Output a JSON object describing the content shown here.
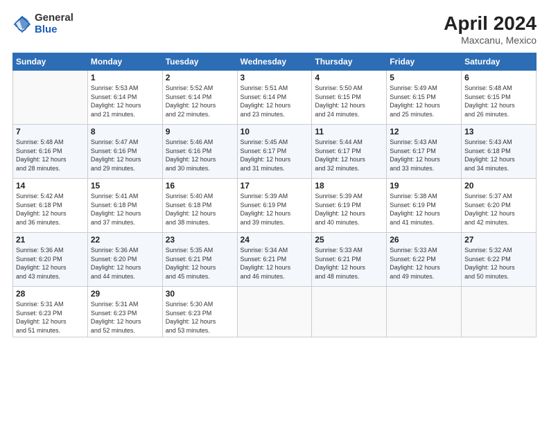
{
  "logo": {
    "general": "General",
    "blue": "Blue"
  },
  "title": "April 2024",
  "subtitle": "Maxcanu, Mexico",
  "days_of_week": [
    "Sunday",
    "Monday",
    "Tuesday",
    "Wednesday",
    "Thursday",
    "Friday",
    "Saturday"
  ],
  "weeks": [
    [
      {
        "num": "",
        "info": ""
      },
      {
        "num": "1",
        "info": "Sunrise: 5:53 AM\nSunset: 6:14 PM\nDaylight: 12 hours\nand 21 minutes."
      },
      {
        "num": "2",
        "info": "Sunrise: 5:52 AM\nSunset: 6:14 PM\nDaylight: 12 hours\nand 22 minutes."
      },
      {
        "num": "3",
        "info": "Sunrise: 5:51 AM\nSunset: 6:14 PM\nDaylight: 12 hours\nand 23 minutes."
      },
      {
        "num": "4",
        "info": "Sunrise: 5:50 AM\nSunset: 6:15 PM\nDaylight: 12 hours\nand 24 minutes."
      },
      {
        "num": "5",
        "info": "Sunrise: 5:49 AM\nSunset: 6:15 PM\nDaylight: 12 hours\nand 25 minutes."
      },
      {
        "num": "6",
        "info": "Sunrise: 5:48 AM\nSunset: 6:15 PM\nDaylight: 12 hours\nand 26 minutes."
      }
    ],
    [
      {
        "num": "7",
        "info": "Sunrise: 5:48 AM\nSunset: 6:16 PM\nDaylight: 12 hours\nand 28 minutes."
      },
      {
        "num": "8",
        "info": "Sunrise: 5:47 AM\nSunset: 6:16 PM\nDaylight: 12 hours\nand 29 minutes."
      },
      {
        "num": "9",
        "info": "Sunrise: 5:46 AM\nSunset: 6:16 PM\nDaylight: 12 hours\nand 30 minutes."
      },
      {
        "num": "10",
        "info": "Sunrise: 5:45 AM\nSunset: 6:17 PM\nDaylight: 12 hours\nand 31 minutes."
      },
      {
        "num": "11",
        "info": "Sunrise: 5:44 AM\nSunset: 6:17 PM\nDaylight: 12 hours\nand 32 minutes."
      },
      {
        "num": "12",
        "info": "Sunrise: 5:43 AM\nSunset: 6:17 PM\nDaylight: 12 hours\nand 33 minutes."
      },
      {
        "num": "13",
        "info": "Sunrise: 5:43 AM\nSunset: 6:18 PM\nDaylight: 12 hours\nand 34 minutes."
      }
    ],
    [
      {
        "num": "14",
        "info": "Sunrise: 5:42 AM\nSunset: 6:18 PM\nDaylight: 12 hours\nand 36 minutes."
      },
      {
        "num": "15",
        "info": "Sunrise: 5:41 AM\nSunset: 6:18 PM\nDaylight: 12 hours\nand 37 minutes."
      },
      {
        "num": "16",
        "info": "Sunrise: 5:40 AM\nSunset: 6:18 PM\nDaylight: 12 hours\nand 38 minutes."
      },
      {
        "num": "17",
        "info": "Sunrise: 5:39 AM\nSunset: 6:19 PM\nDaylight: 12 hours\nand 39 minutes."
      },
      {
        "num": "18",
        "info": "Sunrise: 5:39 AM\nSunset: 6:19 PM\nDaylight: 12 hours\nand 40 minutes."
      },
      {
        "num": "19",
        "info": "Sunrise: 5:38 AM\nSunset: 6:19 PM\nDaylight: 12 hours\nand 41 minutes."
      },
      {
        "num": "20",
        "info": "Sunrise: 5:37 AM\nSunset: 6:20 PM\nDaylight: 12 hours\nand 42 minutes."
      }
    ],
    [
      {
        "num": "21",
        "info": "Sunrise: 5:36 AM\nSunset: 6:20 PM\nDaylight: 12 hours\nand 43 minutes."
      },
      {
        "num": "22",
        "info": "Sunrise: 5:36 AM\nSunset: 6:20 PM\nDaylight: 12 hours\nand 44 minutes."
      },
      {
        "num": "23",
        "info": "Sunrise: 5:35 AM\nSunset: 6:21 PM\nDaylight: 12 hours\nand 45 minutes."
      },
      {
        "num": "24",
        "info": "Sunrise: 5:34 AM\nSunset: 6:21 PM\nDaylight: 12 hours\nand 46 minutes."
      },
      {
        "num": "25",
        "info": "Sunrise: 5:33 AM\nSunset: 6:21 PM\nDaylight: 12 hours\nand 48 minutes."
      },
      {
        "num": "26",
        "info": "Sunrise: 5:33 AM\nSunset: 6:22 PM\nDaylight: 12 hours\nand 49 minutes."
      },
      {
        "num": "27",
        "info": "Sunrise: 5:32 AM\nSunset: 6:22 PM\nDaylight: 12 hours\nand 50 minutes."
      }
    ],
    [
      {
        "num": "28",
        "info": "Sunrise: 5:31 AM\nSunset: 6:23 PM\nDaylight: 12 hours\nand 51 minutes."
      },
      {
        "num": "29",
        "info": "Sunrise: 5:31 AM\nSunset: 6:23 PM\nDaylight: 12 hours\nand 52 minutes."
      },
      {
        "num": "30",
        "info": "Sunrise: 5:30 AM\nSunset: 6:23 PM\nDaylight: 12 hours\nand 53 minutes."
      },
      {
        "num": "",
        "info": ""
      },
      {
        "num": "",
        "info": ""
      },
      {
        "num": "",
        "info": ""
      },
      {
        "num": "",
        "info": ""
      }
    ]
  ]
}
